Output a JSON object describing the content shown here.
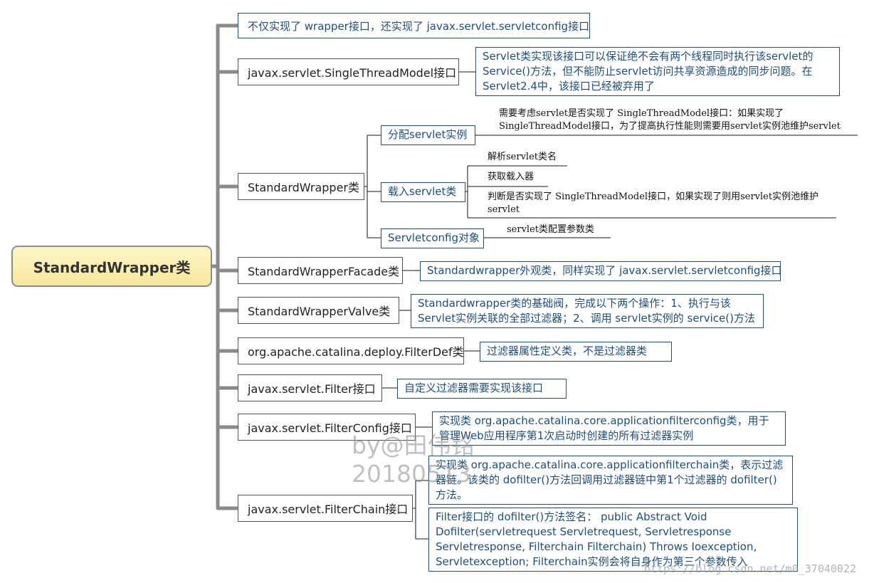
{
  "root": {
    "label": "StandardWrapper类"
  },
  "branches": [
    {
      "label": "不仅实现了 wrapper接口，还实现了 javax.servlet.servletconfig接口"
    },
    {
      "label": "javax.servlet.SingleThreadModel接口"
    },
    {
      "label": "StandardWrapper类"
    },
    {
      "label": "StandardWrapperFacade类"
    },
    {
      "label": "StandardWrapperValve类"
    },
    {
      "label": "org.apache.catalina.deploy.FilterDef类"
    },
    {
      "label": "javax.servlet.Filter接口"
    },
    {
      "label": "javax.servlet.FilterConfig接口"
    },
    {
      "label": "javax.servlet.FilterChain接口"
    }
  ],
  "leaves": {
    "singlethread": "Servlet类实现该接口可以保证绝不会有两个线程同时执行该servlet的Service()方法，但不能防止servlet访问共享资源造成的同步问题。在Servlet2.4中，该接口已经被弃用了",
    "alloc": "分配servlet实例",
    "alloc_note": "需要考虑servlet是否实现了 SingleThreadModel接口：如果实现了 SingleThreadModel接口，为了提高执行性能则需要用servlet实例池维护servlet",
    "load": "载入servlet类",
    "load_note1": "解析servlet类名",
    "load_note2": "获取载入器",
    "load_note3": "判断是否实现了 SingleThreadModel接口，如果实现了则用servlet实例池维护servlet",
    "config": "Servletconfig对象",
    "config_note": "servlet类配置参数类",
    "facade": "Standardwrapper外观类，同样实现了 javax.servlet.servletconfig接口",
    "valve": "Standardwrapper类的基础阀，完成以下两个操作：1、执行与该Servlet实例关联的全部过滤器；2、调用 servlet实例的 service()方法",
    "filterdef": "过滤器属性定义类，不是过滤器类",
    "filter": "自定义过滤器需要实现该接口",
    "filterconfig": "实现类 org.apache.catalina.core.applicationfilterconfig类，用于管理Web应用程序第1次启动时创建的所有过滤器实例",
    "filterchain1": "实现类 org.apache.catalina.core.applicationfilterchain类，表示过滤器链。该类的 dofilter()方法回调用过滤器链中第1个过滤器的 dofilter()方法。",
    "filterchain2": "Filter接口的 dofilter()方法签名： public Abstract Void Dofilter(servletrequest Servletrequest, Servletresponse Servletresponse, Filterchain Filterchain) Throws Ioexception, Servletexception; Filterchain实例会将自身作为第三个参数传入"
  },
  "watermark": {
    "line1": "by@田伟铭",
    "line2": "20180513",
    "url": "https://blog.csdn.net/m0_37040022"
  }
}
